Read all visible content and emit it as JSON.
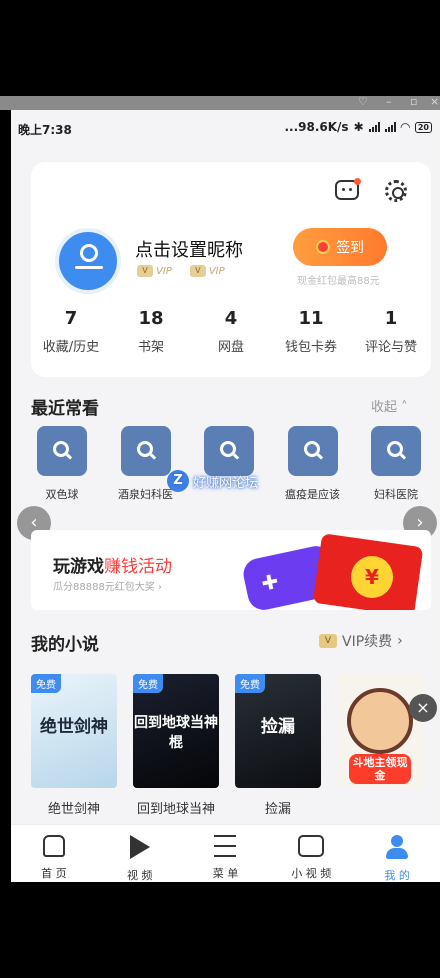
{
  "status_bar": {
    "time": "晚上7:38",
    "net_speed": "...98.6K/s",
    "battery": "20"
  },
  "profile": {
    "nickname": "点击设置昵称",
    "vip1": "VIP",
    "vip2": "VIP",
    "signin_label": "签到",
    "signin_sub": "现金红包最高88元",
    "stats": [
      {
        "num": "7",
        "label": "收藏/历史"
      },
      {
        "num": "18",
        "label": "书架"
      },
      {
        "num": "4",
        "label": "网盘"
      },
      {
        "num": "11",
        "label": "钱包卡券"
      },
      {
        "num": "1",
        "label": "评论与赞"
      }
    ]
  },
  "recent": {
    "title": "最近常看",
    "collapse": "收起",
    "items": [
      {
        "label": "双色球"
      },
      {
        "label": "酒泉妇科医"
      },
      {
        "label": ""
      },
      {
        "label": "瘟疫是应该"
      },
      {
        "label": "妇科医院"
      }
    ]
  },
  "watermark": {
    "z": "Z",
    "text": "好赚网论坛"
  },
  "banner": {
    "title_a": "玩游戏",
    "title_b": "赚钱活动",
    "subtitle": "瓜分88888元红包大奖 ›",
    "coin": "¥"
  },
  "novels": {
    "title": "我的小说",
    "vip_renew": "VIP续费",
    "free_badge": "免费",
    "books": [
      {
        "title": "绝世剑神",
        "cover_text": "绝世剑神"
      },
      {
        "title": "回到地球当神",
        "cover_text": "回到地球当神棍"
      },
      {
        "title": "捡漏",
        "cover_text": "捡漏"
      }
    ],
    "ad_text": "斗地主领现金"
  },
  "tabs": [
    {
      "label": "首 页"
    },
    {
      "label": "视 频"
    },
    {
      "label": "菜 单"
    },
    {
      "label": "小 视 频"
    },
    {
      "label": "我 的"
    }
  ],
  "colors": {
    "accent": "#3f8cf0",
    "signin": "#ff8a33",
    "highlight_red": "#ff3b3b"
  }
}
